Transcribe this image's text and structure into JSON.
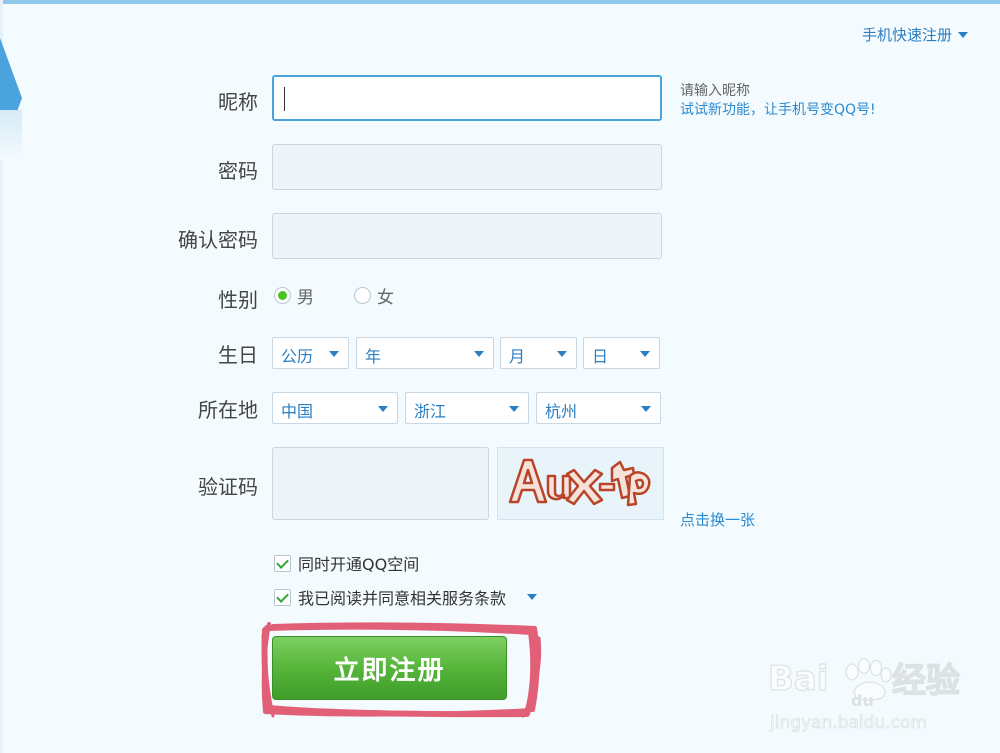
{
  "header": {
    "quick_register": "手机快速注册"
  },
  "form": {
    "nickname": {
      "label": "昵称",
      "value": "",
      "hint": "请输入昵称",
      "promo": "试试新功能，让手机号变QQ号!"
    },
    "password": {
      "label": "密码",
      "value": ""
    },
    "confirm_password": {
      "label": "确认密码",
      "value": ""
    },
    "gender": {
      "label": "性别",
      "options": [
        {
          "label": "男",
          "selected": true
        },
        {
          "label": "女",
          "selected": false
        }
      ]
    },
    "birthday": {
      "label": "生日",
      "calendar": "公历",
      "year": "年",
      "month": "月",
      "day": "日"
    },
    "location": {
      "label": "所在地",
      "country": "中国",
      "province": "浙江",
      "city": "杭州"
    },
    "captcha": {
      "label": "验证码",
      "value": "",
      "image_text": "Aux-tp",
      "refresh": "点击换一张"
    },
    "checks": [
      {
        "label": "同时开通QQ空间",
        "checked": true
      },
      {
        "label": "我已阅读并同意相关服务条款",
        "checked": true
      }
    ],
    "submit": "立即注册"
  },
  "watermark": {
    "brand_prefix": "Bai",
    "brand_suffix": "du",
    "brand_cn": "经验",
    "site": "jingyan.baidu.com"
  },
  "colors": {
    "accent": "#4aa3dd",
    "link": "#2b8ad0",
    "submit_green": "#56b53a",
    "highlight_red": "#e0506a"
  }
}
